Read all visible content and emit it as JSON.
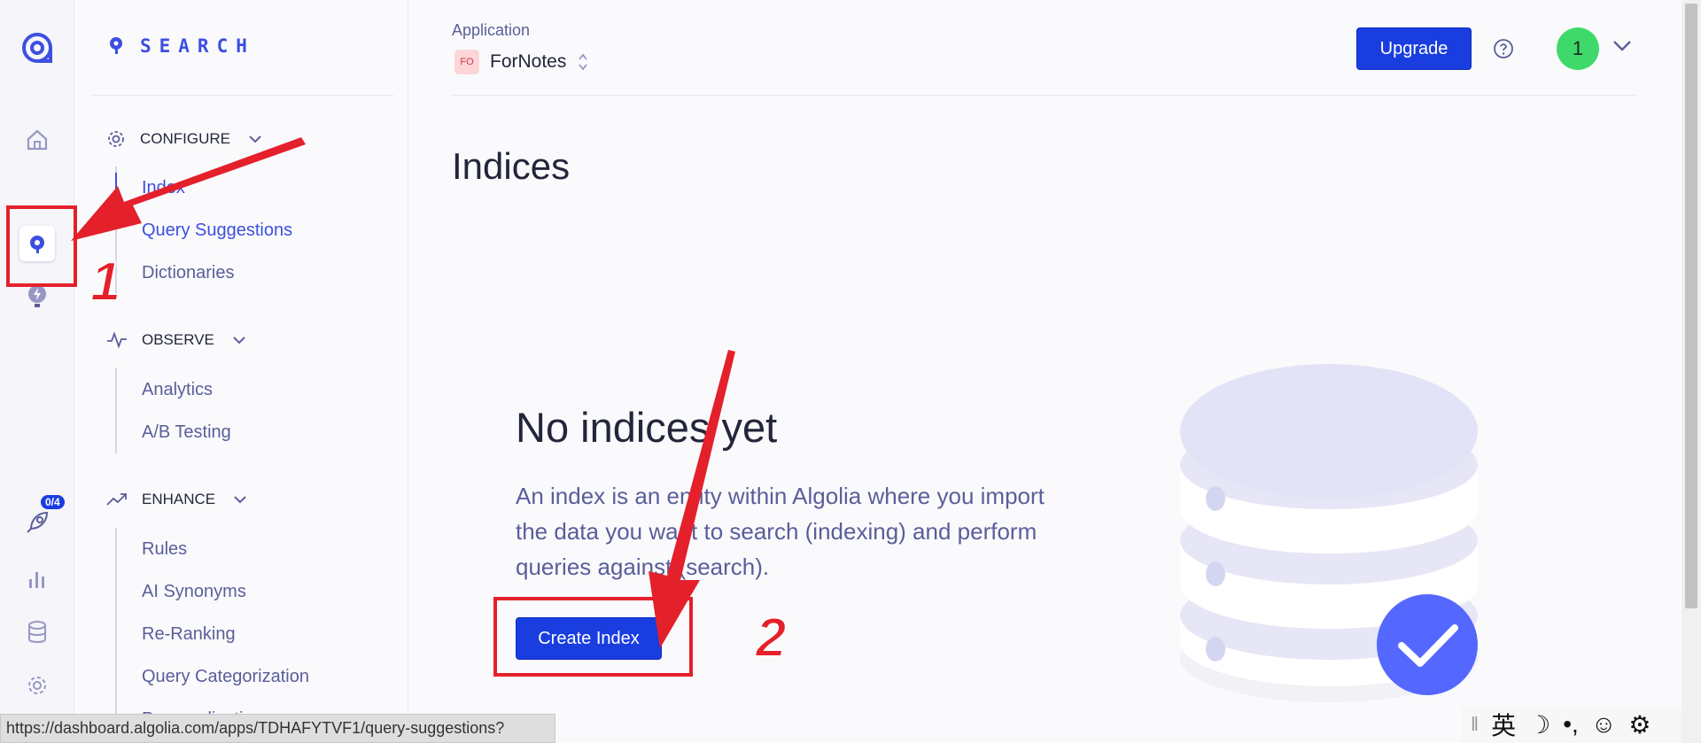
{
  "rail": {
    "badge": "0/4",
    "items": [
      "logo-icon",
      "home-icon",
      "search-icon",
      "ai-bulb-icon",
      "rocket-icon",
      "chart-icon",
      "database-icon",
      "settings-icon"
    ]
  },
  "nav": {
    "brand": "SEARCH",
    "sections": [
      {
        "label": "CONFIGURE",
        "items": [
          "Index",
          "Query Suggestions",
          "Dictionaries"
        ]
      },
      {
        "label": "OBSERVE",
        "items": [
          "Analytics",
          "A/B Testing"
        ]
      },
      {
        "label": "ENHANCE",
        "items": [
          "Rules",
          "AI Synonyms",
          "Re-Ranking",
          "Query Categorization",
          "Personalization"
        ]
      }
    ]
  },
  "header": {
    "application_label": "Application",
    "app_badge": "FO",
    "app_name": "ForNotes",
    "upgrade_label": "Upgrade",
    "avatar_label": "1"
  },
  "main": {
    "title": "Indices",
    "empty_title": "No indices yet",
    "empty_desc": "An index is an entity within Algolia where you import the data you want to search (indexing) and perform queries against (search).",
    "create_label": "Create Index"
  },
  "status": {
    "url": "https://dashboard.algolia.com/apps/TDHAFYTVF1/query-suggestions?"
  },
  "ime": {
    "lang": "英",
    "moon": "☽",
    "punct": "•,",
    "smile": "☺",
    "gear": "⚙"
  },
  "annotations": {
    "step1": "1",
    "step2": "2"
  },
  "colors": {
    "accent": "#3c4fe0",
    "button": "#1a3de0",
    "annotation": "#e4202b",
    "avatar": "#3ed96a"
  }
}
